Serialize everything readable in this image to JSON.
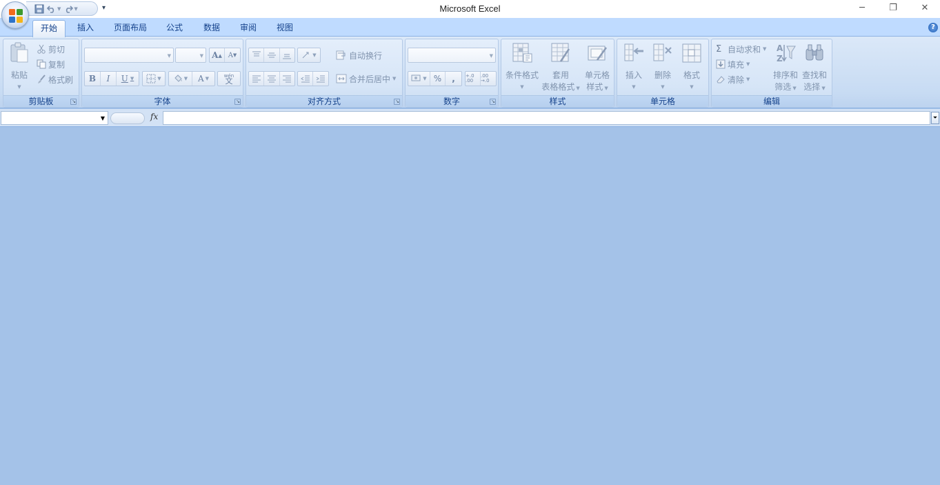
{
  "app": {
    "title": "Microsoft Excel"
  },
  "quick_access": {
    "save": "save-icon",
    "undo": "undo-icon",
    "redo": "redo-icon",
    "customize": "▾"
  },
  "window_controls": {
    "minimize": "─",
    "restore": "❐",
    "close": "✕"
  },
  "tabs": [
    "开始",
    "插入",
    "页面布局",
    "公式",
    "数据",
    "审阅",
    "视图"
  ],
  "active_tab": "开始",
  "help": "?",
  "ribbon": {
    "clipboard": {
      "label": "剪贴板",
      "paste": "粘贴",
      "cut": "剪切",
      "copy": "复制",
      "format_painter": "格式刷"
    },
    "font": {
      "label": "字体",
      "font_name": "",
      "font_size": "",
      "grow": "A",
      "shrink": "A",
      "bold": "B",
      "italic": "I",
      "underline": "U",
      "font_color": "A",
      "phonetic": "wén"
    },
    "alignment": {
      "label": "对齐方式",
      "wrap_text": "自动换行",
      "merge_center": "合并后居中"
    },
    "number": {
      "label": "数字",
      "format": "",
      "percent": "%",
      "comma": ",",
      "inc_decimal": "+.0 .00",
      "dec_decimal": ".00 →.0"
    },
    "styles": {
      "label": "样式",
      "conditional": "条件格式",
      "table_line1": "套用",
      "table_line2": "表格格式",
      "cell_line1": "单元格",
      "cell_line2": "样式"
    },
    "cells": {
      "label": "单元格",
      "insert": "插入",
      "delete": "删除",
      "format": "格式"
    },
    "editing": {
      "label": "编辑",
      "autosum": "自动求和",
      "sigma": "Σ",
      "fill": "填充",
      "clear": "清除",
      "sort_line1": "排序和",
      "sort_line2": "筛选",
      "find_line1": "查找和",
      "find_line2": "选择"
    }
  },
  "formula_bar": {
    "name_box": "",
    "fx": "fx",
    "formula": ""
  },
  "colors": {
    "workspace": "#a4c2e8",
    "tab_text": "#15428b",
    "disabled_text": "#8194ae"
  }
}
